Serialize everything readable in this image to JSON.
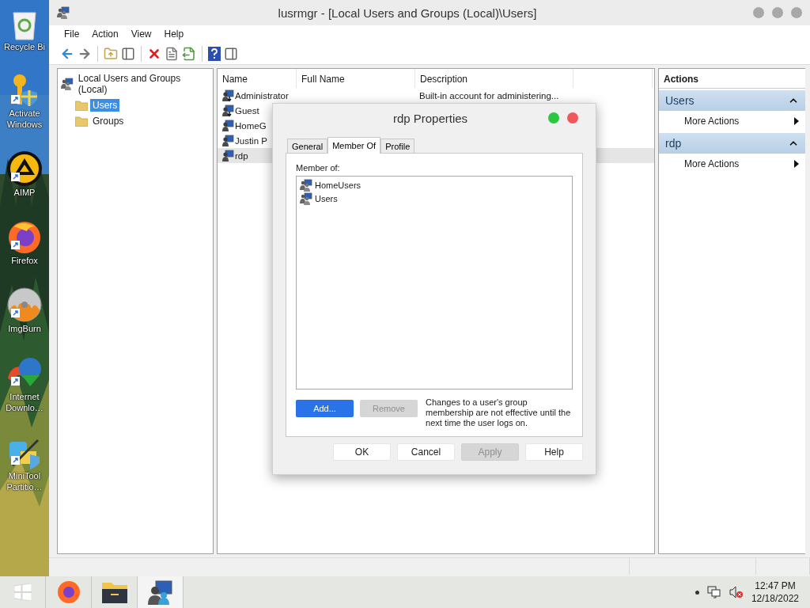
{
  "window": {
    "title": "lusrmgr - [Local Users and Groups (Local)\\Users]"
  },
  "menu": [
    "File",
    "Action",
    "View",
    "Help"
  ],
  "tree": [
    {
      "label": "Local Users and Groups (Local)",
      "selected": false,
      "children": [
        {
          "label": "Users",
          "selected": true
        },
        {
          "label": "Groups",
          "selected": false
        }
      ]
    }
  ],
  "list": {
    "columns": [
      "Name",
      "Full Name",
      "Description"
    ],
    "rows": [
      {
        "name": "Administrator",
        "full_name": "",
        "description": "Built-in account for administering...",
        "disabled": true,
        "selected": false
      },
      {
        "name": "Guest",
        "full_name": "",
        "description": "",
        "disabled": true,
        "selected": false
      },
      {
        "name": "HomeG",
        "full_name": "",
        "description": "",
        "disabled": false,
        "selected": false
      },
      {
        "name": "Justin P",
        "full_name": "",
        "description": "",
        "disabled": false,
        "selected": false
      },
      {
        "name": "rdp",
        "full_name": "",
        "description": "",
        "disabled": false,
        "selected": true
      }
    ]
  },
  "actions": {
    "title": "Actions",
    "sections": [
      {
        "title": "Users",
        "expanded": true,
        "items": [
          "More Actions"
        ]
      },
      {
        "title": "rdp",
        "expanded": true,
        "items": [
          "More Actions"
        ]
      }
    ]
  },
  "dialog": {
    "title": "rdp Properties",
    "tabs": [
      {
        "label": "General",
        "selected": false
      },
      {
        "label": "Member Of",
        "selected": true
      },
      {
        "label": "Profile",
        "selected": false
      }
    ],
    "member_label": "Member of:",
    "groups": [
      "HomeUsers",
      "Users"
    ],
    "buttons": [
      {
        "label": "Add...",
        "kind": "primary",
        "disabled": false
      },
      {
        "label": "Remove",
        "kind": "normal",
        "disabled": true
      }
    ],
    "note": "Changes to a user's group membership are not effective until the next time the user logs on.",
    "footer": [
      {
        "label": "OK",
        "disabled": false
      },
      {
        "label": "Cancel",
        "disabled": false
      },
      {
        "label": "Apply",
        "disabled": true
      },
      {
        "label": "Help",
        "disabled": false
      }
    ]
  },
  "desktop_icons": [
    {
      "label": "Recycle Bi",
      "kind": "bin"
    },
    {
      "label": "Activate Windows",
      "kind": "key"
    },
    {
      "label": "AIMP",
      "kind": "aimp"
    },
    {
      "label": "Firefox",
      "kind": "firefox"
    },
    {
      "label": "ImgBurn",
      "kind": "disc"
    },
    {
      "label": "Internet Downlo…",
      "kind": "globe"
    },
    {
      "label": "MiniTool Partitio…",
      "kind": "tool"
    }
  ],
  "taskbar": {
    "apps": [
      {
        "kind": "firefox",
        "active": false
      },
      {
        "kind": "folder",
        "active": false
      },
      {
        "kind": "users",
        "active": true
      }
    ],
    "time": "12:47 PM",
    "date": "12/18/2022"
  }
}
